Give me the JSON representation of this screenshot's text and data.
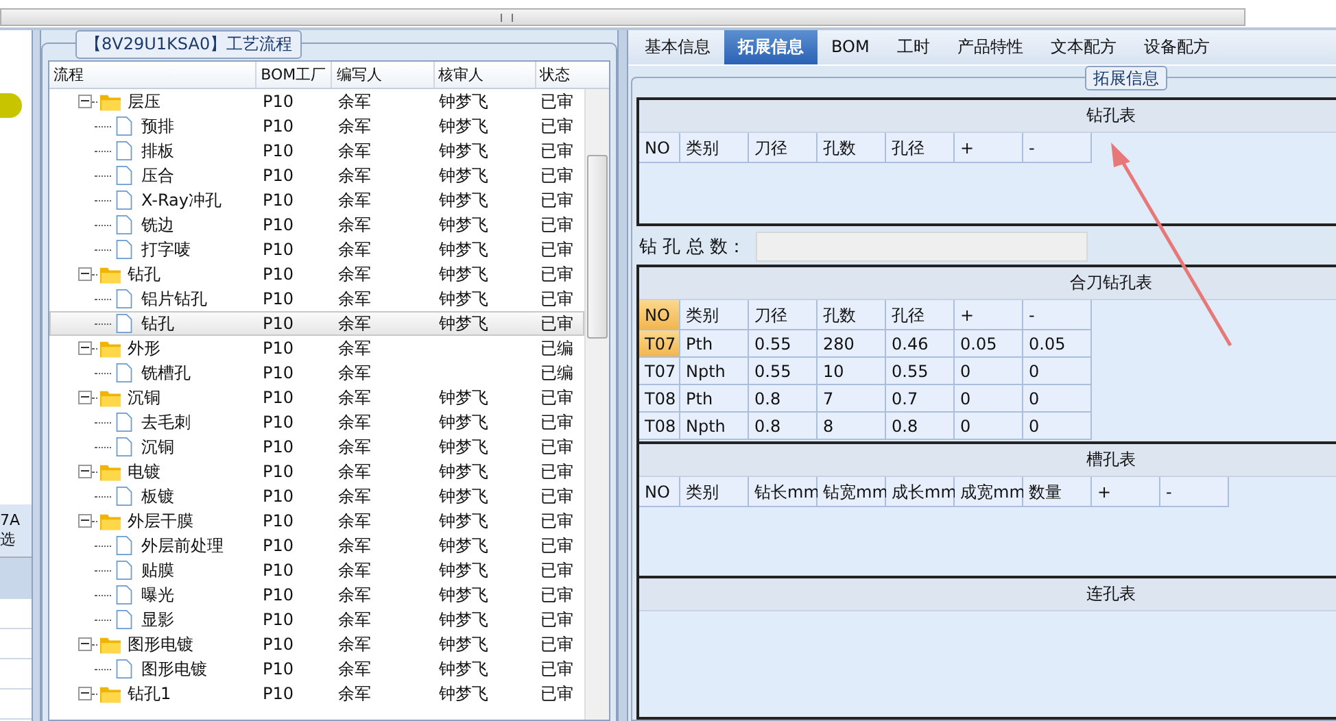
{
  "left_panel": {
    "header_lines": [
      "7A",
      "选"
    ]
  },
  "process_panel": {
    "title": "【8V29U1KSA0】工艺流程",
    "columns": [
      "流程",
      "BOM工厂",
      "编写人",
      "核审人",
      "状态"
    ],
    "rows": [
      {
        "kind": "folder",
        "name": "层压",
        "bom": "P10",
        "writer": "余军",
        "reviewer": "钟梦飞",
        "status": "已审",
        "expanded": true,
        "selected": false,
        "children": [
          {
            "kind": "file",
            "name": "预排",
            "bom": "P10",
            "writer": "余军",
            "reviewer": "钟梦飞",
            "status": "已审",
            "selected": false
          },
          {
            "kind": "file",
            "name": "排板",
            "bom": "P10",
            "writer": "余军",
            "reviewer": "钟梦飞",
            "status": "已审",
            "selected": false
          },
          {
            "kind": "file",
            "name": "压合",
            "bom": "P10",
            "writer": "余军",
            "reviewer": "钟梦飞",
            "status": "已审",
            "selected": false
          },
          {
            "kind": "file",
            "name": "X-Ray冲孔",
            "bom": "P10",
            "writer": "余军",
            "reviewer": "钟梦飞",
            "status": "已审",
            "selected": false
          },
          {
            "kind": "file",
            "name": "铣边",
            "bom": "P10",
            "writer": "余军",
            "reviewer": "钟梦飞",
            "status": "已审",
            "selected": false
          },
          {
            "kind": "file",
            "name": "打字唛",
            "bom": "P10",
            "writer": "余军",
            "reviewer": "钟梦飞",
            "status": "已审",
            "selected": false
          }
        ]
      },
      {
        "kind": "folder",
        "name": "钻孔",
        "bom": "P10",
        "writer": "余军",
        "reviewer": "钟梦飞",
        "status": "已审",
        "expanded": true,
        "selected": false,
        "children": [
          {
            "kind": "file",
            "name": "铝片钻孔",
            "bom": "P10",
            "writer": "余军",
            "reviewer": "钟梦飞",
            "status": "已审",
            "selected": false
          },
          {
            "kind": "file",
            "name": "钻孔",
            "bom": "P10",
            "writer": "余军",
            "reviewer": "钟梦飞",
            "status": "已审",
            "selected": true
          }
        ]
      },
      {
        "kind": "folder",
        "name": "外形",
        "bom": "P10",
        "writer": "余军",
        "status": "已编",
        "expanded": true,
        "selected": false,
        "children": [
          {
            "kind": "file",
            "name": "铣槽孔",
            "bom": "P10",
            "writer": "余军",
            "status": "已编",
            "selected": false
          }
        ]
      },
      {
        "kind": "folder",
        "name": "沉铜",
        "bom": "P10",
        "writer": "余军",
        "reviewer": "钟梦飞",
        "status": "已审",
        "expanded": true,
        "selected": false,
        "children": [
          {
            "kind": "file",
            "name": "去毛刺",
            "bom": "P10",
            "writer": "余军",
            "reviewer": "钟梦飞",
            "status": "已审",
            "selected": false
          },
          {
            "kind": "file",
            "name": "沉铜",
            "bom": "P10",
            "writer": "余军",
            "reviewer": "钟梦飞",
            "status": "已审",
            "selected": false
          }
        ]
      },
      {
        "kind": "folder",
        "name": "电镀",
        "bom": "P10",
        "writer": "余军",
        "reviewer": "钟梦飞",
        "status": "已审",
        "expanded": true,
        "selected": false,
        "children": [
          {
            "kind": "file",
            "name": "板镀",
            "bom": "P10",
            "writer": "余军",
            "reviewer": "钟梦飞",
            "status": "已审",
            "selected": false
          }
        ]
      },
      {
        "kind": "folder",
        "name": "外层干膜",
        "bom": "P10",
        "writer": "余军",
        "reviewer": "钟梦飞",
        "status": "已审",
        "expanded": true,
        "selected": false,
        "children": [
          {
            "kind": "file",
            "name": "外层前处理",
            "bom": "P10",
            "writer": "余军",
            "reviewer": "钟梦飞",
            "status": "已审",
            "selected": false
          },
          {
            "kind": "file",
            "name": "贴膜",
            "bom": "P10",
            "writer": "余军",
            "reviewer": "钟梦飞",
            "status": "已审",
            "selected": false
          },
          {
            "kind": "file",
            "name": "曝光",
            "bom": "P10",
            "writer": "余军",
            "reviewer": "钟梦飞",
            "status": "已审",
            "selected": false
          },
          {
            "kind": "file",
            "name": "显影",
            "bom": "P10",
            "writer": "余军",
            "reviewer": "钟梦飞",
            "status": "已审",
            "selected": false
          }
        ]
      },
      {
        "kind": "folder",
        "name": "图形电镀",
        "bom": "P10",
        "writer": "余军",
        "reviewer": "钟梦飞",
        "status": "已审",
        "expanded": true,
        "selected": false,
        "children": [
          {
            "kind": "file",
            "name": "图形电镀",
            "bom": "P10",
            "writer": "余军",
            "reviewer": "钟梦飞",
            "status": "已审",
            "selected": false
          }
        ]
      },
      {
        "kind": "folder",
        "name": "钻孔1",
        "bom": "P10",
        "writer": "余军",
        "reviewer": "钟梦飞",
        "status": "已审",
        "expanded": true,
        "selected": false
      }
    ]
  },
  "tabs": [
    {
      "label": "基本信息",
      "selected": false
    },
    {
      "label": "拓展信息",
      "selected": true
    },
    {
      "label": "BOM",
      "selected": false
    },
    {
      "label": "工时",
      "selected": false
    },
    {
      "label": "产品特性",
      "selected": false
    },
    {
      "label": "文本配方",
      "selected": false
    },
    {
      "label": "设备配方",
      "selected": false
    }
  ],
  "group_title": "拓展信息",
  "sections": [
    {
      "kind": "table",
      "title": "钻孔表",
      "columns": [
        "NO",
        "类别",
        "刀径",
        "孔数",
        "孔径",
        "+",
        "-"
      ]
    },
    {
      "kind": "total",
      "label": "钻 孔 总 数："
    },
    {
      "kind": "table",
      "title": "合刀钻孔表",
      "columns": [
        "NO",
        "类别",
        "刀径",
        "孔数",
        "孔径",
        "+",
        "-"
      ],
      "rows": [
        {
          "selected": true,
          "cells": [
            "T07",
            "Pth",
            "0.55",
            "280",
            "0.46",
            "0.05",
            "0.05"
          ]
        },
        {
          "selected": false,
          "cells": [
            "T07",
            "Npth",
            "0.55",
            "10",
            "0.55",
            "0",
            "0"
          ]
        },
        {
          "selected": false,
          "cells": [
            "T08",
            "Pth",
            "0.8",
            "7",
            "0.7",
            "0",
            "0"
          ]
        },
        {
          "selected": false,
          "cells": [
            "T08",
            "Npth",
            "0.8",
            "8",
            "0.8",
            "0",
            "0"
          ]
        }
      ]
    },
    {
      "kind": "table",
      "title": "槽孔表",
      "columns": [
        "NO",
        "类别",
        "钻长mm",
        "钻宽mm",
        "成长mm",
        "成宽mm",
        "数量",
        "+",
        "-"
      ]
    },
    {
      "kind": "table",
      "title": "连孔表"
    }
  ]
}
